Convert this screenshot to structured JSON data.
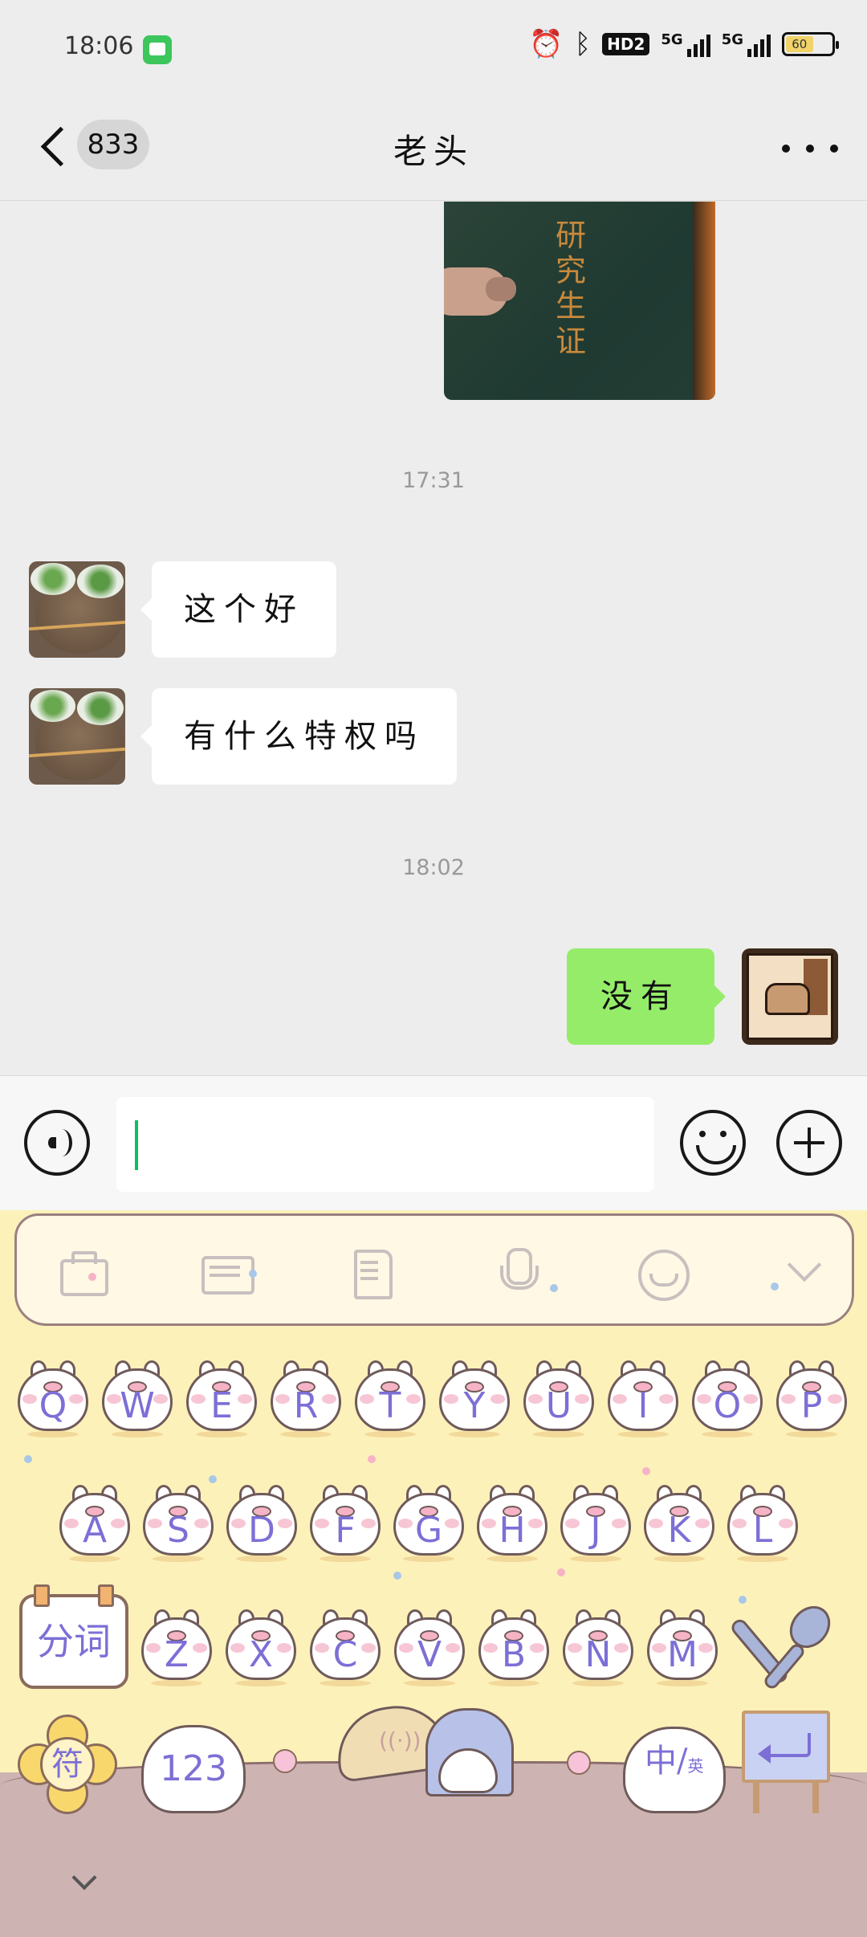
{
  "status_bar": {
    "time": "18:06",
    "hd_label": "HD2",
    "sim1_label": "5G",
    "sim2_label": "5G",
    "battery": "60",
    "icons": [
      "wechat-app-icon",
      "alarm-icon",
      "bluetooth-icon",
      "hd-icon",
      "signal-icon",
      "signal-icon",
      "battery-icon"
    ]
  },
  "nav": {
    "unread_count": "833",
    "title": "老头",
    "back_icon": "back-chevron-icon",
    "more_icon": "more-dots-icon"
  },
  "messages": {
    "image_caption_chars": [
      "研",
      "究",
      "生",
      "证"
    ],
    "timestamp_1": "17:31",
    "msg_1": "这个好",
    "msg_2": "有什么特权吗",
    "timestamp_2": "18:02",
    "msg_3": "没有"
  },
  "input_bar": {
    "value": "",
    "voice_icon": "voice-icon",
    "emoji_icon": "emoji-icon",
    "plus_icon": "plus-icon"
  },
  "keyboard": {
    "toolbar_icons": [
      "briefcase-icon",
      "keyboard-icon",
      "clipboard-icon",
      "microphone-icon",
      "emoji-icon",
      "chevron-down-icon"
    ],
    "row1": [
      "Q",
      "W",
      "E",
      "R",
      "T",
      "Y",
      "U",
      "I",
      "O",
      "P"
    ],
    "row2": [
      "A",
      "S",
      "D",
      "F",
      "G",
      "H",
      "J",
      "K",
      "L"
    ],
    "row3": [
      "Z",
      "X",
      "C",
      "V",
      "B",
      "N",
      "M"
    ],
    "segment_label": "分词",
    "symbol_label": "符",
    "number_label": "123",
    "lang_primary": "中",
    "lang_secondary": "英",
    "space_mic": "((·))",
    "backspace_icon": "fork-spoon-backspace-icon",
    "enter_icon": "enter-arrow-icon",
    "collapse_icon": "chevron-down-icon"
  },
  "colors": {
    "outgoing_bubble": "#95ec69",
    "incoming_bubble": "#ffffff",
    "chat_bg": "#ededed",
    "caret": "#07c160",
    "keyboard_bg": "#fdf1ba",
    "key_label": "#7c6fd6"
  }
}
